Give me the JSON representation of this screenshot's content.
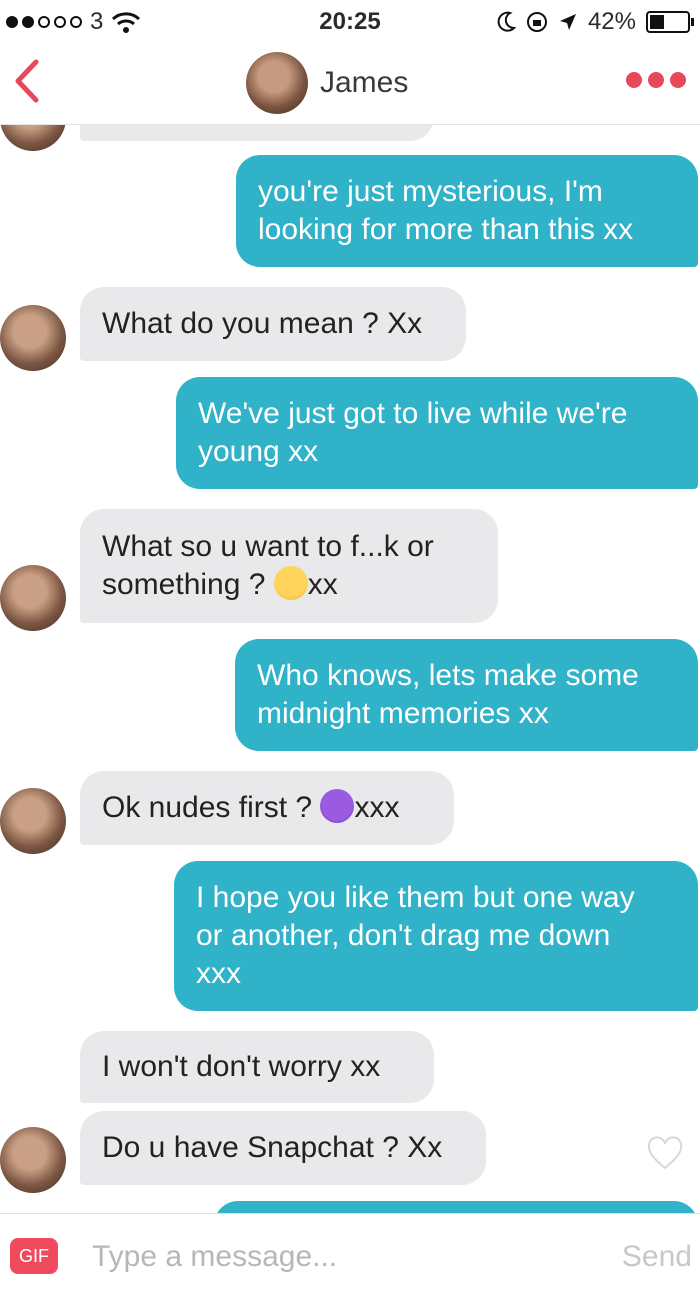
{
  "status_bar": {
    "carrier": "3",
    "time": "20:25",
    "battery": "42%"
  },
  "header": {
    "contact_name": "James"
  },
  "messages": [
    {
      "from": "them",
      "text": ""
    },
    {
      "from": "me",
      "lines": [
        "you're just mysterious, I'm",
        "looking for more than this xx"
      ]
    },
    {
      "from": "them",
      "lines": [
        "What do you mean ? Xx"
      ]
    },
    {
      "from": "me",
      "lines": [
        "We've just got to live while we're",
        "young xx"
      ]
    },
    {
      "from": "them",
      "lines": [
        "What so u want to f...k or",
        "something ?",
        "xx"
      ],
      "emoji": "face-with-tears-of-joy"
    },
    {
      "from": "me",
      "lines": [
        "Who knows, lets make some",
        "midnight memories xx"
      ]
    },
    {
      "from": "them",
      "lines": [
        "Ok nudes first ?",
        "xxx"
      ],
      "emoji": "smiling-devil"
    },
    {
      "from": "me",
      "lines": [
        "I hope you like them but one way",
        "or another, don't drag me down",
        "xxx"
      ]
    },
    {
      "from": "them",
      "lines": [
        "I won't don't worry xx"
      ]
    },
    {
      "from": "them",
      "lines": [
        "Do u have Snapchat ? Xx"
      ]
    }
  ],
  "composer": {
    "gif_label": "GIF",
    "placeholder": "Type a message...",
    "send_label": "Send"
  },
  "colors": {
    "accent": "#e8495a",
    "outgoing_bubble": "#30b2c8",
    "incoming_bubble": "#e9e9eb"
  }
}
